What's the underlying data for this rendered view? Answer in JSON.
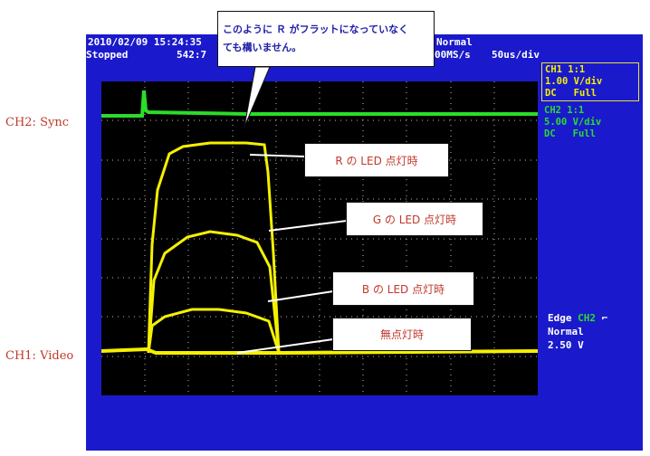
{
  "labels": {
    "sync": "CH2: Sync",
    "video": "CH1: Video"
  },
  "header": {
    "datetime": "2010/02/09 15:24:35",
    "status": "Stopped",
    "position": "542:7",
    "trigger_mode": "Normal",
    "sample_rate": "00MS/s",
    "time_div": "50us/div"
  },
  "channels": {
    "ch1": {
      "title": "CH1 1:1",
      "scale": "1.00 V/div",
      "coupling": "DC",
      "bw": "Full"
    },
    "ch2": {
      "title": "CH2 1:1",
      "scale": "5.00 V/div",
      "coupling": "DC",
      "bw": "Full"
    }
  },
  "trigger": {
    "type": "Edge",
    "source": "CH2",
    "mode": "Normal",
    "level": "2.50 V"
  },
  "callouts": {
    "note_line1": "このように Ｒ がフラットになっていなく",
    "note_line2": "ても構いません。",
    "r": "R の LED 点灯時",
    "g": "G の LED 点灯時",
    "b": "B の LED 点灯時",
    "none": "無点灯時"
  },
  "colors": {
    "scope_bg": "#1a1acc",
    "trace_ch1": "#f5f000",
    "trace_ch2": "#2bdc2b"
  }
}
